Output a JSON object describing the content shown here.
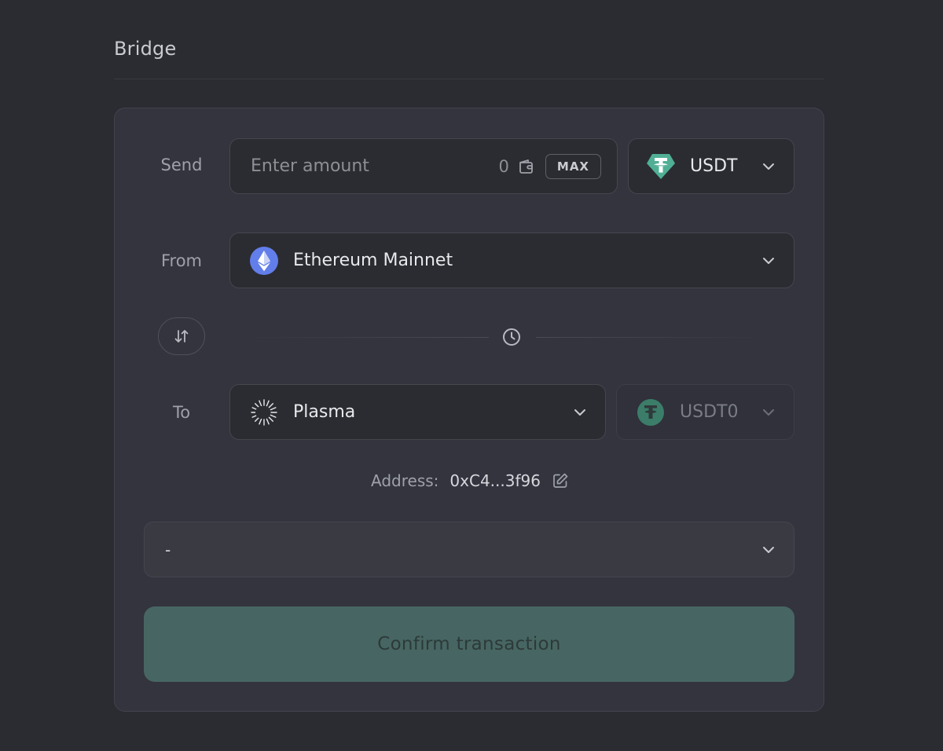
{
  "page": {
    "title": "Bridge"
  },
  "send": {
    "label": "Send",
    "amount_placeholder": "Enter amount",
    "balance": "0",
    "max_label": "MAX",
    "token": "USDT"
  },
  "from": {
    "label": "From",
    "chain": "Ethereum Mainnet"
  },
  "to": {
    "label": "To",
    "chain": "Plasma",
    "token": "USDT0"
  },
  "address": {
    "label": "Address:",
    "value": "0xC4...3f96"
  },
  "details": {
    "value": "-"
  },
  "confirm": {
    "label": "Confirm transaction"
  },
  "colors": {
    "background": "#2b2c31",
    "card": "#33343e",
    "usdt_green": "#50af95",
    "usdt0_green": "#3b7d69",
    "ethereum": "#627eea",
    "confirm_button": "#476663"
  },
  "icons": {
    "wallet": "wallet-icon",
    "usdt": "usdt-logo-icon",
    "ethereum": "ethereum-logo-icon",
    "plasma": "plasma-logo-icon",
    "usdt0": "usdt0-logo-icon",
    "swap": "swap-arrows-icon",
    "clock": "clock-icon",
    "edit": "edit-icon",
    "chevron": "chevron-down-icon"
  }
}
